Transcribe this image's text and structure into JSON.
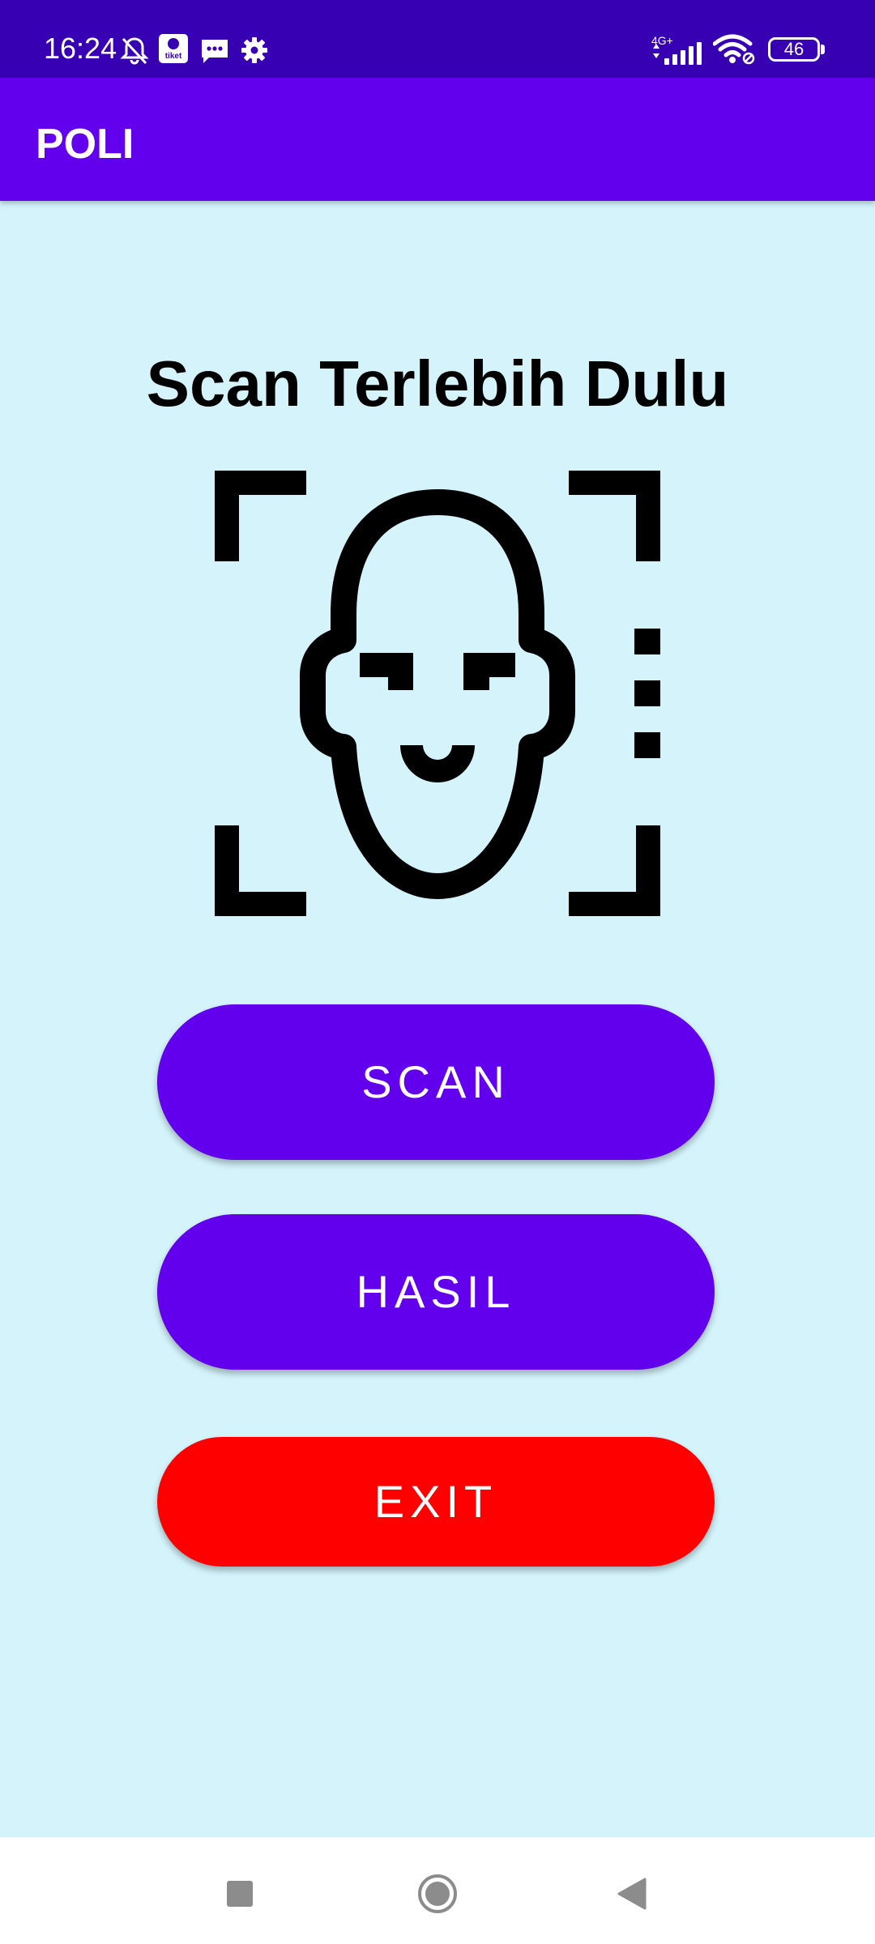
{
  "status_bar": {
    "time": "16:24",
    "notification_badge": "tiket",
    "network": "4G+",
    "battery": "46"
  },
  "app_bar": {
    "title": "POLI"
  },
  "main": {
    "heading": "Scan Terlebih Dulu",
    "face_icon": "face-scan-icon",
    "buttons": {
      "scan": {
        "label": "SCAN",
        "color": "#6200ee"
      },
      "hasil": {
        "label": "HASIL",
        "color": "#6200ee"
      },
      "exit": {
        "label": "EXIT",
        "color": "#ff0000"
      }
    }
  },
  "colors": {
    "status_bar": "#3700b3",
    "app_bar": "#6200ee",
    "background": "#d4f3fb"
  },
  "nav_bar": {
    "icons": [
      "recents-square-icon",
      "home-circle-icon",
      "back-triangle-icon"
    ]
  }
}
